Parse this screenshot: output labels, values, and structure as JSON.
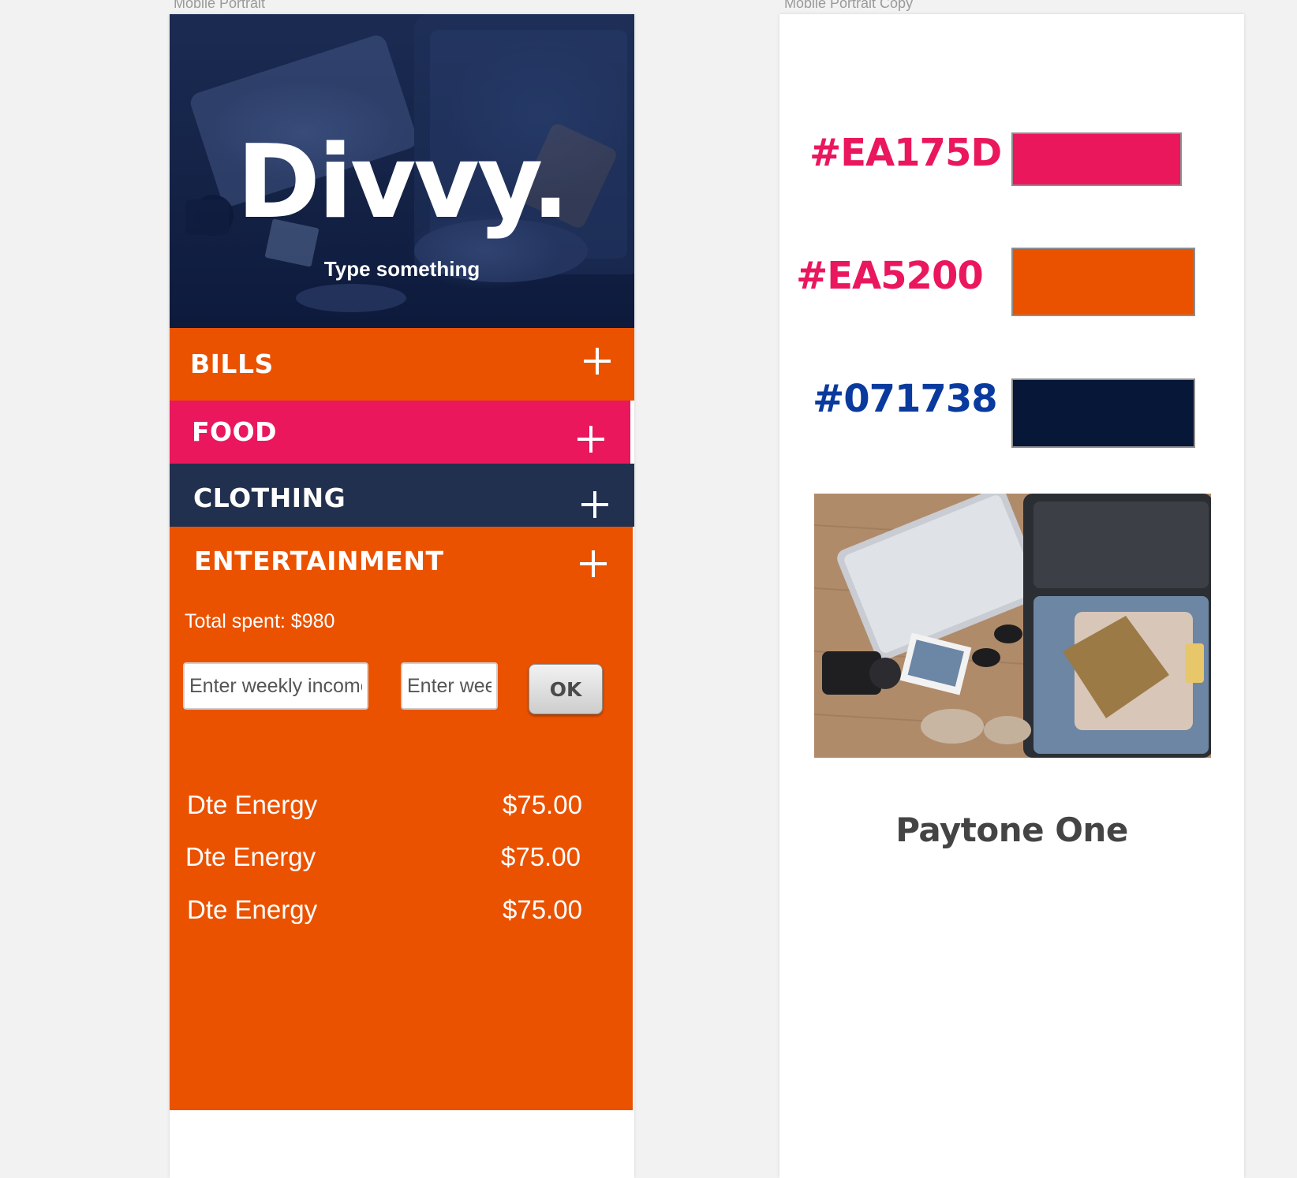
{
  "artboards": {
    "left_label": "Mobile Portrait",
    "right_label": "Mobile Portrait Copy"
  },
  "app": {
    "title": "Divvy.",
    "subtitle": "Type something",
    "categories": [
      {
        "label": "BILLS",
        "color": "#EA5200"
      },
      {
        "label": "FOOD",
        "color": "#EA175D"
      },
      {
        "label": "CLOTHING",
        "color": "#22304f"
      },
      {
        "label": "ENTERTAINMENT",
        "color": "#EA5200"
      }
    ],
    "total_spent": "Total spent: $980",
    "income_placeholder": "Enter weekly income",
    "second_placeholder": "Enter weekly",
    "ok_label": "OK",
    "bills": [
      {
        "name": "Dte Energy",
        "amount": "$75.00"
      },
      {
        "name": "Dte Energy",
        "amount": "$75.00"
      },
      {
        "name": "Dte Energy",
        "amount": "$75.00"
      }
    ]
  },
  "style_guide": {
    "colors": [
      {
        "hex": "#EA175D",
        "label_color": "#EA175D",
        "swatch": "#EA175D"
      },
      {
        "hex": "#EA5200",
        "label_color": "#EA175D",
        "swatch": "#EA5200"
      },
      {
        "hex": "#071738",
        "label_color": "#0a3a9e",
        "swatch": "#071738"
      }
    ],
    "font_name": "Paytone One"
  }
}
